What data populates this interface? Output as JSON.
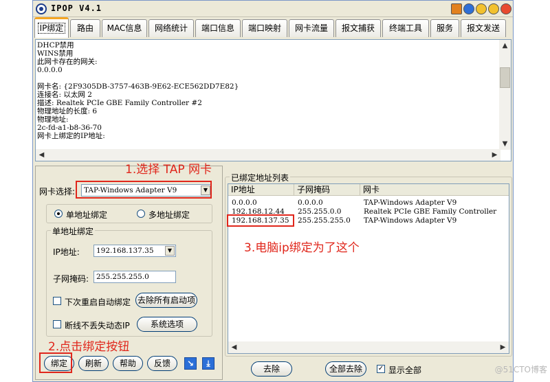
{
  "window": {
    "title": "IPOP V4.1"
  },
  "tabs": [
    {
      "label": "IP绑定",
      "active": true
    },
    {
      "label": "路由"
    },
    {
      "label": "MAC信息"
    },
    {
      "label": "网络统计"
    },
    {
      "label": "端口信息"
    },
    {
      "label": "端口映射"
    },
    {
      "label": "网卡流量"
    },
    {
      "label": "报文捕获"
    },
    {
      "label": "终端工具"
    },
    {
      "label": "服务"
    },
    {
      "label": "报文发送"
    }
  ],
  "log": {
    "lines": [
      "DHCP禁用",
      "WINS禁用",
      "此网卡存在的网关:",
      "0.0.0.0",
      "",
      "网卡名: {2F9305DB-3757-463B-9E62-ECE562DD7E82}",
      "连接名: 以太网 2",
      "描述: Realtek PCIe GBE Family Controller #2",
      "物理地址的长度: 6",
      "物理地址:",
      "2c-fd-a1-b8-36-70",
      "网卡上绑定的IP地址:"
    ]
  },
  "left": {
    "nic_label": "网卡选择:",
    "nic_value": "TAP-Windows Adapter V9",
    "mode_single": "单地址绑定",
    "mode_multi": "多地址绑定",
    "group_title": "单地址绑定",
    "ip_label": "IP地址:",
    "ip_value": "192.168.137.35",
    "mask_label": "子网掩码:",
    "mask_value": "255.255.255.0",
    "auto_bind_label": "下次重启自动绑定",
    "remove_auto_label": "去除所有启动项",
    "keep_dynamic_label": "断线不丢失动态IP",
    "sys_options_label": "系统选项",
    "btn_bind": "绑定",
    "btn_refresh": "刷新",
    "btn_help": "帮助",
    "btn_feedback": "反馈"
  },
  "right": {
    "group_title": "已绑定地址列表",
    "columns": [
      "IP地址",
      "子网掩码",
      "网卡"
    ],
    "rows": [
      [
        "0.0.0.0",
        "0.0.0.0",
        "TAP-Windows Adapter V9"
      ],
      [
        "192.168.12.44",
        "255.255.0.0",
        "Realtek PCIe GBE Family Controller"
      ],
      [
        "192.168.137.35",
        "255.255.255.0",
        "TAP-Windows Adapter V9"
      ]
    ],
    "btn_remove": "去除",
    "btn_remove_all": "全部去除",
    "show_all_label": "显示全部"
  },
  "annotations": {
    "step1": "1.选择 TAP 网卡",
    "step2": "2.点击绑定按钮",
    "step3": "3.电脑ip绑定为了这个"
  },
  "watermark": "@51CTO博客",
  "colors": {
    "annotation": "#e0261b",
    "tab_accent": "#f5a623"
  }
}
